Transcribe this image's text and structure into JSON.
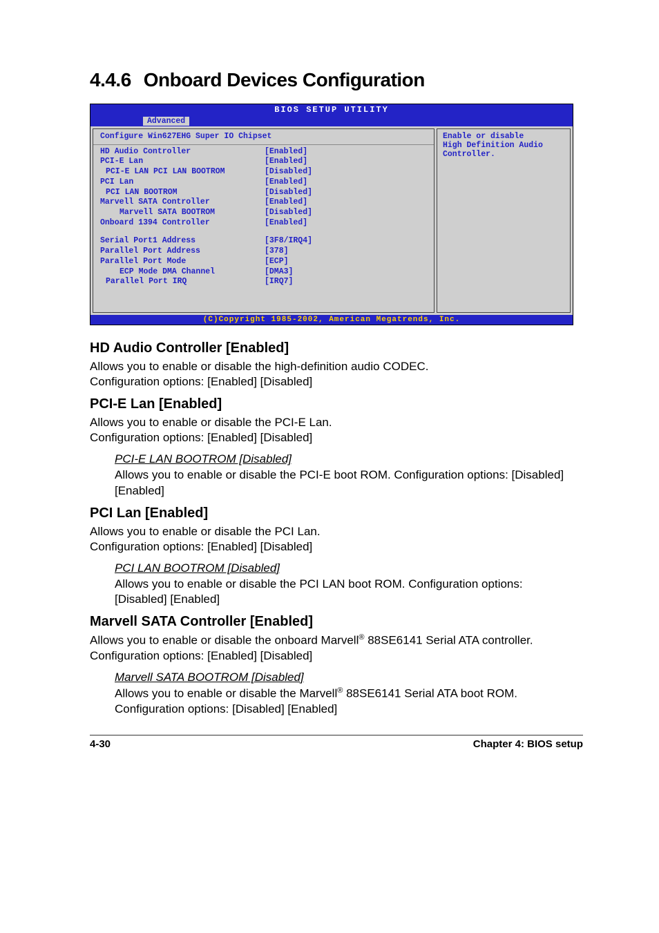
{
  "heading": {
    "number": "4.4.6",
    "title": "Onboard Devices Configuration"
  },
  "bios": {
    "utility_title": "BIOS SETUP UTILITY",
    "tab": "Advanced",
    "subhead": "Configure Win627EHG Super IO Chipset",
    "items": [
      {
        "label": "HD Audio Controller",
        "value": "[Enabled]",
        "indent": 0
      },
      {
        "label": "PCI-E Lan",
        "value": "[Enabled]",
        "indent": 0
      },
      {
        "label": "PCI-E LAN PCI LAN BOOTROM",
        "value": "[Disabled]",
        "indent": 1
      },
      {
        "label": "PCI Lan",
        "value": "[Enabled]",
        "indent": 0
      },
      {
        "label": "PCI LAN BOOTROM",
        "value": "[Disabled]",
        "indent": 1
      },
      {
        "label": "Marvell SATA Controller",
        "value": "[Enabled]",
        "indent": 0
      },
      {
        "label": "Marvell SATA BOOTROM",
        "value": "[Disabled]",
        "indent": 2
      },
      {
        "label": "Onboard 1394 Controller",
        "value": "[Enabled]",
        "indent": 0
      }
    ],
    "items2": [
      {
        "label": "Serial Port1 Address",
        "value": "[3F8/IRQ4]",
        "indent": 0
      },
      {
        "label": "Parallel Port Address",
        "value": "[378]",
        "indent": 0
      },
      {
        "label": "Parallel Port Mode",
        "value": "[ECP]",
        "indent": 0
      },
      {
        "label": "ECP Mode DMA Channel",
        "value": "[DMA3]",
        "indent": 2
      },
      {
        "label": "Parallel Port IRQ",
        "value": "[IRQ7]",
        "indent": 1
      }
    ],
    "help_l1": "Enable or disable",
    "help_l2": "High Definition Audio",
    "help_l3": "Controller.",
    "copyright": "(C)Copyright 1985-2002, American Megatrends, Inc."
  },
  "sec1": {
    "title": "HD Audio Controller [Enabled]",
    "p1": "Allows you to enable or disable the high-definition audio CODEC.",
    "p2": "Configuration options: [Enabled] [Disabled]"
  },
  "sec2": {
    "title": "PCI-E Lan [Enabled]",
    "p1": "Allows you to enable or disable the PCI-E Lan.",
    "p2": "Configuration options: [Enabled] [Disabled]",
    "sub_title": "PCI-E LAN BOOTROM [Disabled]",
    "sub_p": "Allows you to enable or disable the PCI-E boot ROM. Configuration options: [Disabled] [Enabled]"
  },
  "sec3": {
    "title": "PCI Lan [Enabled]",
    "p1": "Allows you to enable or disable the PCI Lan.",
    "p2": "Configuration options: [Enabled] [Disabled]",
    "sub_title": "PCI LAN BOOTROM [Disabled]",
    "sub_p": "Allows you to enable or disable the PCI LAN boot ROM. Configuration options: [Disabled] [Enabled]"
  },
  "sec4": {
    "title": "Marvell SATA Controller [Enabled]",
    "p1a": "Allows you to enable or disable the onboard Marvell",
    "p1b": " 88SE6141 Serial ATA controller. Configuration options: [Enabled] [Disabled]",
    "sub_title": "Marvell  SATA BOOTROM [Disabled]",
    "sub_pa": "Allows you to enable or disable the Marvell",
    "sub_pb": " 88SE6141 Serial ATA boot ROM. Configuration options: [Disabled] [Enabled]"
  },
  "footer": {
    "page": "4-30",
    "chapter": "Chapter 4: BIOS setup"
  },
  "reg": "®"
}
